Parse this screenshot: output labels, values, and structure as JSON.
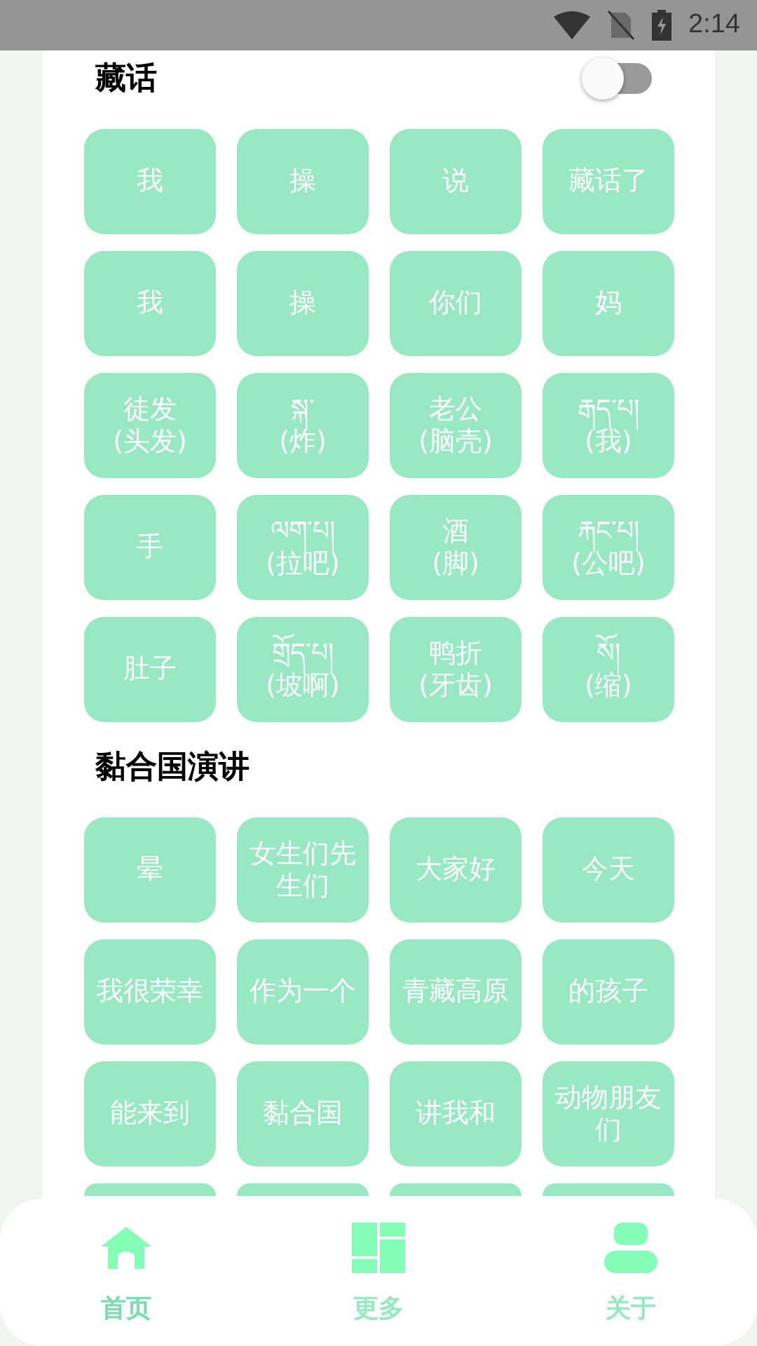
{
  "status_bar": {
    "time": "2:14"
  },
  "sections": [
    {
      "title": "藏话",
      "toggle": {
        "on": false
      },
      "tiles": [
        {
          "label": "我"
        },
        {
          "label": "操"
        },
        {
          "label": "说"
        },
        {
          "label": "藏话了"
        },
        {
          "label": "我"
        },
        {
          "label": "操"
        },
        {
          "label": "你们"
        },
        {
          "label": "妈"
        },
        {
          "label": "徒发\n(头发)"
        },
        {
          "label": "སྐ་\n(炸)"
        },
        {
          "label": "老公\n(脑壳)"
        },
        {
          "label": "རྒད་པ།\n(我)"
        },
        {
          "label": "手"
        },
        {
          "label": "ལག་པ།\n(拉吧)"
        },
        {
          "label": "酒\n(脚)"
        },
        {
          "label": "རྐང་པ།\n(公吧)"
        },
        {
          "label": "肚子"
        },
        {
          "label": "གྲོད་པ།\n(坡啊)"
        },
        {
          "label": "鸭折\n(牙齿)"
        },
        {
          "label": "སོ།\n(缩)"
        }
      ]
    },
    {
      "title": "黏合国演讲",
      "tiles": [
        {
          "label": "晕"
        },
        {
          "label": "女生们先生们"
        },
        {
          "label": "大家好"
        },
        {
          "label": "今天"
        },
        {
          "label": "我很荣幸"
        },
        {
          "label": "作为一个"
        },
        {
          "label": "青藏高原"
        },
        {
          "label": "的孩子"
        },
        {
          "label": "能来到"
        },
        {
          "label": "黏合国"
        },
        {
          "label": "讲我和"
        },
        {
          "label": "动物朋友们"
        },
        {
          "kind": "peek"
        },
        {
          "kind": "peek"
        },
        {
          "kind": "peek"
        },
        {
          "kind": "peek"
        }
      ]
    }
  ],
  "nav": [
    {
      "kind": "home",
      "label": "首页",
      "selected": true
    },
    {
      "kind": "more",
      "label": "更多",
      "selected": false
    },
    {
      "kind": "about",
      "label": "关于",
      "selected": false
    }
  ]
}
